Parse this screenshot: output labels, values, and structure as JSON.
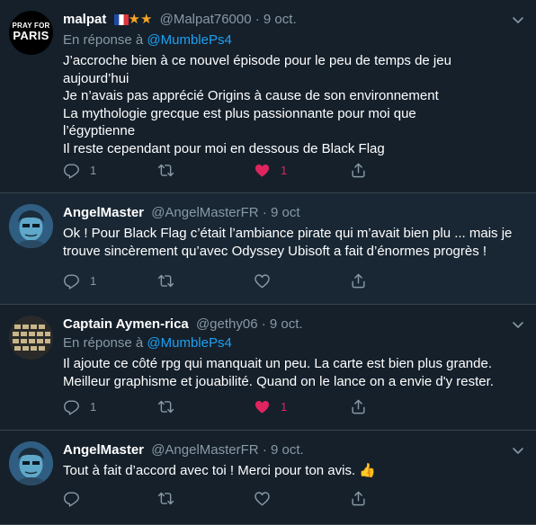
{
  "tweets": [
    {
      "name": "malpat",
      "handle": "@Malpat76000",
      "date": "9 oct.",
      "reply_prefix": "En réponse à",
      "reply_to": "@MumblePs4",
      "avatar_text": [
        "PRAY FOR",
        "PARIS"
      ],
      "lines": [
        "J’accroche bien à ce nouvel épisode pour le peu de temps de jeu",
        "aujourd’hui",
        "Je n’avais pas apprécié Origins à cause de son environnement",
        "La mythologie grecque est plus passionnante pour moi que",
        "l’égyptienne",
        "Il reste cependant pour moi en dessous de Black Flag"
      ],
      "reply_count": "1",
      "like_count": "1",
      "liked": true
    },
    {
      "name": "AngelMaster",
      "handle": "@AngelMasterFR",
      "date": "9 oct",
      "lines": [
        "Ok ! Pour Black Flag c’était l’ambiance pirate qui m’avait bien plu ... mais je",
        "trouve sincèrement qu’avec Odyssey Ubisoft a fait d’énormes progrès !"
      ],
      "reply_count": "1"
    },
    {
      "name": "Captain Aymen-rica",
      "handle": "@gethy06",
      "date": "9 oct.",
      "reply_prefix": "En réponse à",
      "reply_to": "@MumblePs4",
      "lines": [
        "Il ajoute ce côté rpg qui manquait un peu. La carte est bien plus grande.",
        "Meilleur graphisme et jouabilité. Quand on le lance on a envie d'y rester."
      ],
      "reply_count": "1",
      "like_count": "1",
      "liked": true
    },
    {
      "name": "AngelMaster",
      "handle": "@AngelMasterFR",
      "date": "9 oct.",
      "text": "Tout à fait d’accord avec toi ! Merci pour ton avis.",
      "emoji": "👍"
    }
  ],
  "colors": {
    "background": "#15202b",
    "highlight_background": "#192734",
    "border": "#38444d",
    "secondary_text": "#8899a6",
    "link": "#1da1f2",
    "like": "#e0245e",
    "star": "#f5a623"
  },
  "icons": {
    "flag": "flag-france-icon",
    "star": "star-icon",
    "reply": "reply-icon",
    "retweet": "retweet-icon",
    "like": "heart-icon",
    "share": "share-icon",
    "more": "chevron-down-icon"
  }
}
